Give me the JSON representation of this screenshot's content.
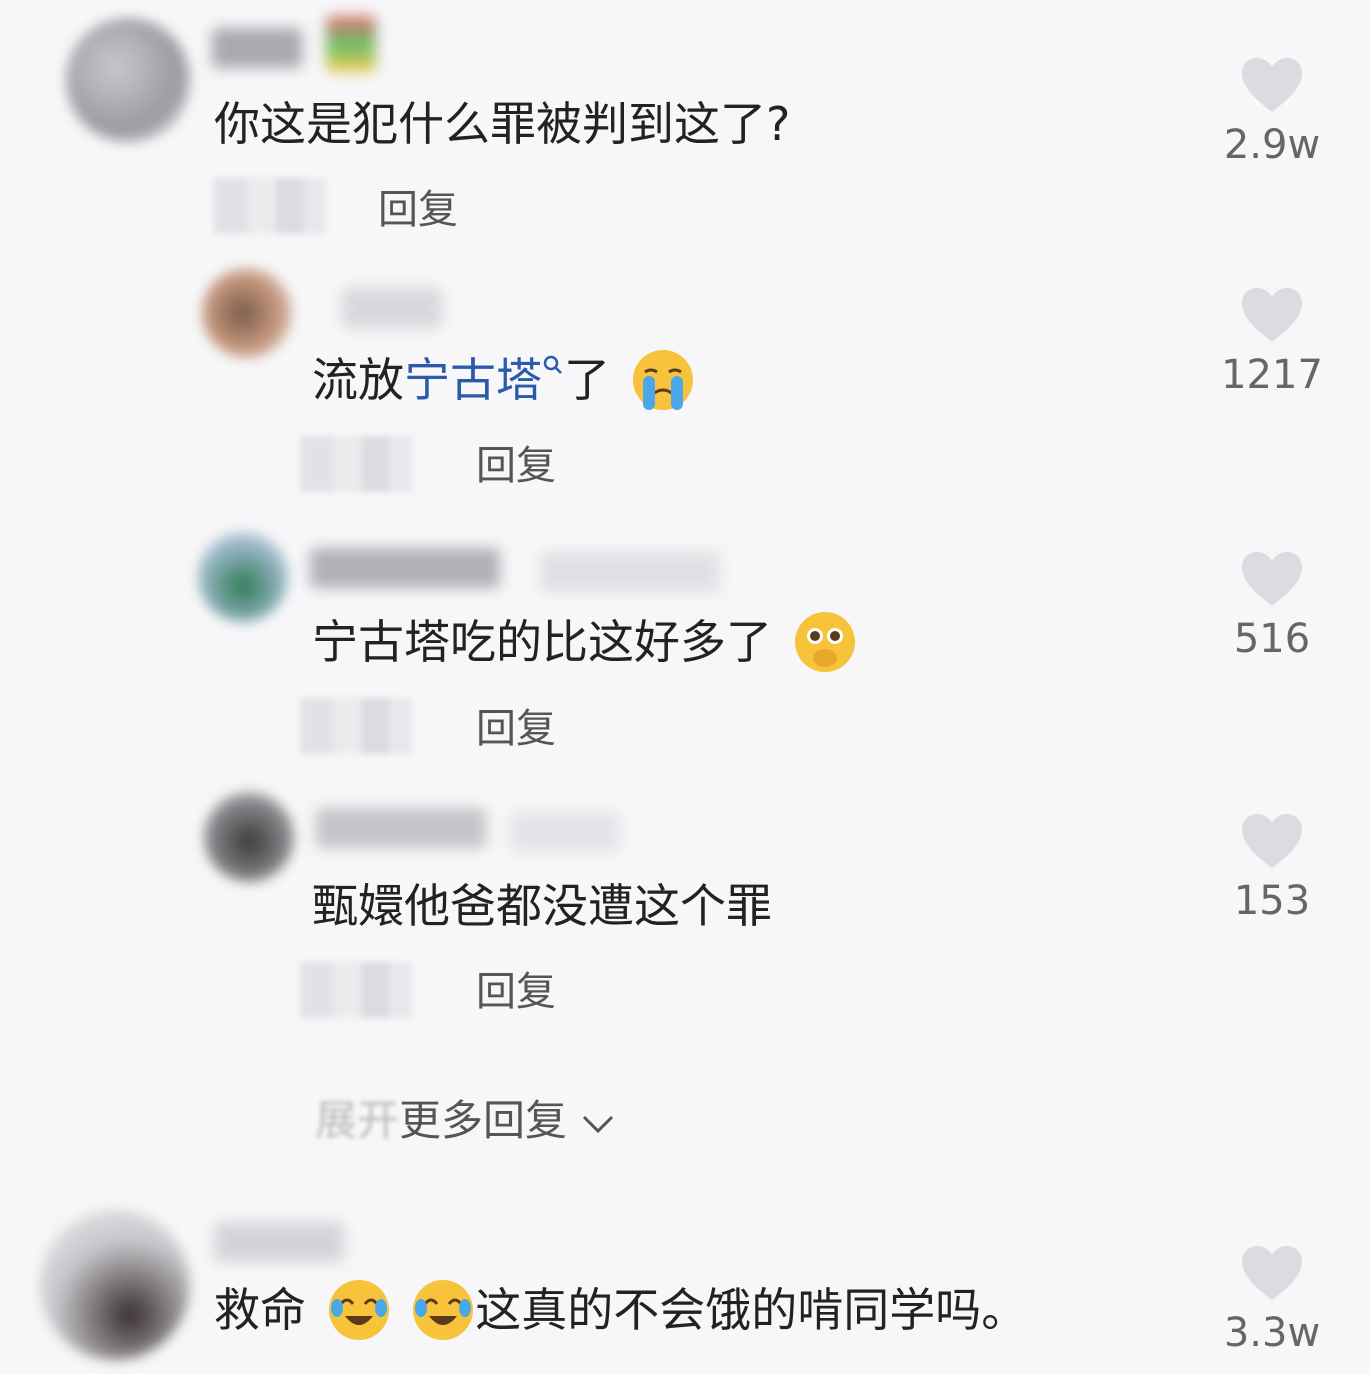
{
  "comments": [
    {
      "text": "你这是犯什么罪被判到这了?",
      "reply": "回复",
      "likes": "2.9w"
    },
    {
      "text_pre": "流放",
      "text_link": "宁古塔",
      "text_post": "了",
      "emoji": "crying-face",
      "reply": "回复",
      "likes": "1217"
    },
    {
      "text": "宁古塔吃的比这好多了",
      "emoji": "pleading-hands-face",
      "reply": "回复",
      "likes": "516"
    },
    {
      "text": "甄嬛他爸都没遭这个罪",
      "reply": "回复",
      "likes": "153"
    },
    {
      "text_pre": "救命",
      "text_post": "这真的不会饿的啃同学吗。",
      "emoji": "tears-of-joy-face",
      "likes": "3.3w"
    }
  ],
  "expand_more": {
    "faded_prefix": "展开",
    "label": "更多回复"
  },
  "colors": {
    "background": "#f7f7f9",
    "link": "#2b5aa8",
    "heart": "#dcdce0"
  }
}
